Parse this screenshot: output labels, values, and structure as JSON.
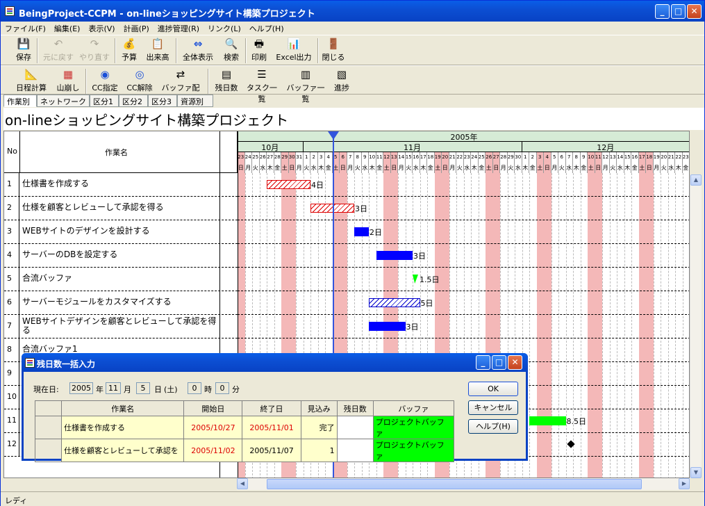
{
  "window": {
    "title": "BeingProject-CCPM - on-lineショッピングサイト構築プロジェクト",
    "minimize": "_",
    "maximize": "□",
    "close": "✕"
  },
  "menu": [
    "ファイル(F)",
    "編集(E)",
    "表示(V)",
    "計画(P)",
    "進捗管理(R)",
    "リンク(L)",
    "ヘルプ(H)"
  ],
  "toolbar1": [
    {
      "label": "保存",
      "icon": "💾"
    },
    {
      "label": "元に戻す",
      "icon": "↶"
    },
    {
      "label": "やり直す",
      "icon": "↷"
    },
    {
      "label": "予算",
      "icon": "💰"
    },
    {
      "label": "出来高",
      "icon": "📋"
    },
    {
      "label": "全体表示",
      "icon": "⇔"
    },
    {
      "label": "検索",
      "icon": "🔍"
    },
    {
      "label": "印刷",
      "icon": "🖶"
    },
    {
      "label": "Excel出力",
      "icon": "📊"
    },
    {
      "label": "閉じる",
      "icon": "🚪"
    }
  ],
  "toolbar2": [
    {
      "label": "日程計算",
      "icon": "📐"
    },
    {
      "label": "山崩し",
      "icon": "▦"
    },
    {
      "label": "CC指定",
      "icon": "◉"
    },
    {
      "label": "CC解除",
      "icon": "◎"
    },
    {
      "label": "バッファ配置",
      "icon": "⇄"
    },
    {
      "label": "残日数",
      "icon": "▤"
    },
    {
      "label": "タスク一覧",
      "icon": "☰"
    },
    {
      "label": "バッファ一覧",
      "icon": "▥"
    },
    {
      "label": "進捗",
      "icon": "▧"
    }
  ],
  "tabs": [
    "作業別",
    "ネットワーク図",
    "区分1",
    "区分2",
    "区分3",
    "資源別"
  ],
  "project_title": "on-lineショッピングサイト構築プロジェクト",
  "header": {
    "no": "No",
    "name": "作業名",
    "year": "2005年",
    "months": [
      "10月",
      "11月",
      "12月"
    ]
  },
  "days": [
    "23",
    "24",
    "25",
    "26",
    "27",
    "28",
    "29",
    "30",
    "31",
    "1",
    "2",
    "3",
    "4",
    "5",
    "6",
    "7",
    "8",
    "9",
    "10",
    "11",
    "12",
    "13",
    "14",
    "15",
    "16",
    "17",
    "18",
    "19",
    "20",
    "21",
    "22",
    "23",
    "24",
    "25",
    "26",
    "27",
    "28",
    "29",
    "30",
    "1",
    "2",
    "3",
    "4",
    "5",
    "6",
    "7",
    "8",
    "9",
    "10",
    "11",
    "12",
    "13",
    "14",
    "15",
    "16",
    "17",
    "18",
    "19",
    "20",
    "21",
    "22",
    "23"
  ],
  "weekdays": [
    "日",
    "月",
    "火",
    "水",
    "木",
    "金",
    "土",
    "日",
    "月",
    "火",
    "水",
    "木",
    "金",
    "土",
    "日",
    "月",
    "火",
    "水",
    "木",
    "金",
    "土",
    "日",
    "月",
    "火",
    "水",
    "木",
    "金",
    "土",
    "日",
    "月",
    "火",
    "水",
    "木",
    "金",
    "土",
    "日",
    "月",
    "火",
    "水",
    "木",
    "金",
    "土",
    "日",
    "月",
    "火",
    "水",
    "木",
    "金",
    "土",
    "日",
    "月",
    "火",
    "水",
    "木",
    "金",
    "土",
    "日",
    "月",
    "火",
    "水",
    "木",
    "金"
  ],
  "tasks": [
    {
      "no": "1",
      "name": "仕様書を作成する",
      "dur": "4日"
    },
    {
      "no": "2",
      "name": "仕様を顧客とレビューして承認を得る",
      "dur": "3日"
    },
    {
      "no": "3",
      "name": "WEBサイトのデザインを設計する",
      "dur": "2日"
    },
    {
      "no": "4",
      "name": "サーバーのDBを設定する",
      "dur": "3日"
    },
    {
      "no": "5",
      "name": "合流バッファ",
      "dur": "1.5日"
    },
    {
      "no": "6",
      "name": "サーバーモジュールをカスタマイズする",
      "dur": "5日"
    },
    {
      "no": "7",
      "name": "WEBサイトデザインを顧客とレビューして承認を得る",
      "dur": "3日"
    },
    {
      "no": "8",
      "name": "合流バッファ1",
      "dur": ""
    },
    {
      "no": "9",
      "name": "",
      "dur": ""
    },
    {
      "no": "10",
      "name": "",
      "dur": ""
    },
    {
      "no": "11",
      "name": "",
      "dur": "8.5日"
    },
    {
      "no": "12",
      "name": "",
      "dur": ""
    }
  ],
  "status": "レディ",
  "dialog": {
    "title": "残日数一括入力",
    "now_label": "現在日:",
    "year": "2005",
    "year_unit": "年",
    "month": "11",
    "month_unit": "月",
    "day": "5",
    "day_unit": "日",
    "weekday": "(土)",
    "hour": "0",
    "hour_unit": "時",
    "minute": "0",
    "minute_unit": "分",
    "columns": [
      "作業名",
      "開始日",
      "終了日",
      "見込み",
      "残日数",
      "バッファ"
    ],
    "rows": [
      {
        "name": "仕様書を作成する",
        "start": "2005/10/27",
        "end": "2005/11/01",
        "forecast": "完了",
        "remain": "",
        "buffer": "プロジェクトバッファ"
      },
      {
        "name": "仕様を顧客とレビューして承認を",
        "start": "2005/11/02",
        "end": "2005/11/07",
        "forecast": "1",
        "remain": "",
        "buffer": "プロジェクトバッファ"
      }
    ],
    "ok": "OK",
    "cancel": "キャンセル",
    "help": "ヘルプ(H)"
  },
  "colors": {
    "weekend": "#f4b8b8",
    "bar_blue": "#0000ff",
    "bar_green": "#00ff00",
    "title_blue": "#0842c4"
  }
}
